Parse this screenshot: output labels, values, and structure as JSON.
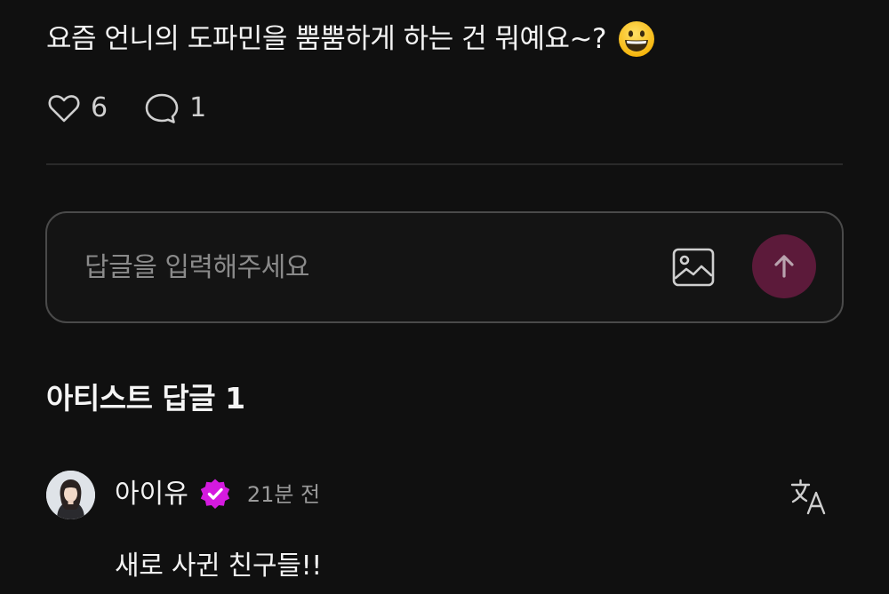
{
  "post": {
    "text": "요즘 언니의 도파민을 뿜뿜하게 하는 건 뭐예요~?",
    "emoji": "grinning-face-emoji"
  },
  "actions": {
    "like_count": "6",
    "comment_count": "1",
    "like_icon": "heart-icon",
    "comment_icon": "speech-bubble-icon"
  },
  "reply": {
    "placeholder": "답글을 입력해주세요",
    "value": "",
    "image_icon": "image-icon",
    "send_icon": "arrow-up-icon",
    "send_bg_color": "#5c1a3a"
  },
  "artist_replies": {
    "title": "아티스트 답글 1"
  },
  "comment": {
    "author": "아이유",
    "verified_color": "#d41adf",
    "time": "21분 전",
    "body": "새로 사귄 친구들!!",
    "translate_icon": "translate-icon"
  }
}
